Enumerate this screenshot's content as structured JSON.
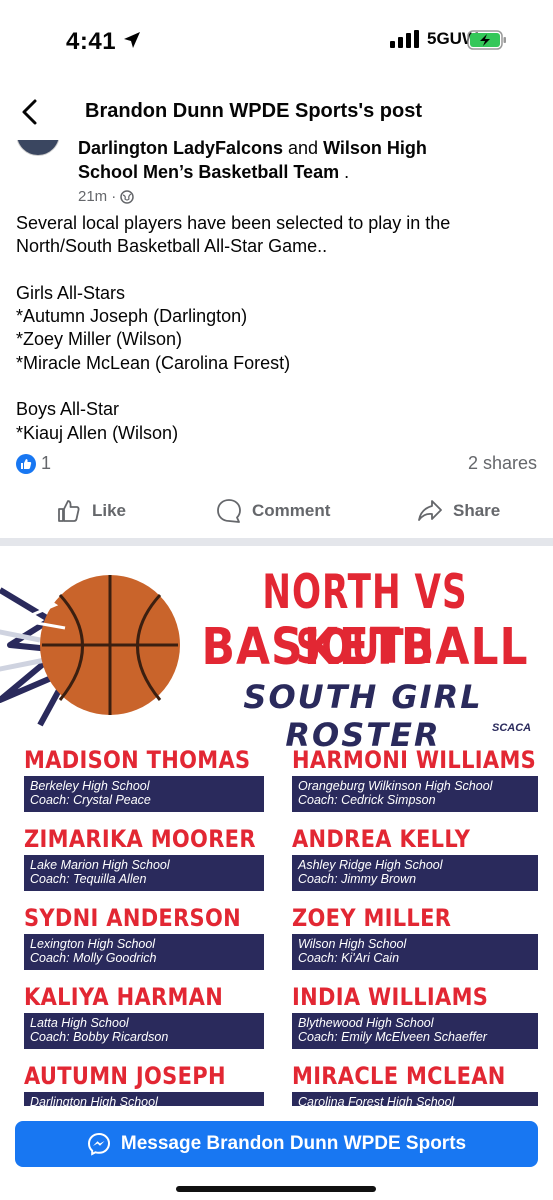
{
  "status_bar": {
    "time": "4:41",
    "network": "5GUW"
  },
  "nav": {
    "title": "Brandon Dunn WPDE Sports's post"
  },
  "post": {
    "header_line1_bold_a": "Darlington LadyFalcons",
    "header_line1_thin": " and ",
    "header_line1_bold_b": "Wilson High",
    "header_line2": "School Men’s Basketball Team",
    "header_line2_tail": " .",
    "time": "21m",
    "body": "Several local players have been selected to play in the North/South Basketball All-Star Game..\n\nGirls All-Stars\n*Autumn Joseph (Darlington)\n*Zoey Miller (Wilson)\n*Miracle McLean (Carolina Forest)\n\nBoys All-Star\n*Kiauj Allen (Wilson)",
    "reaction_count": "1",
    "shares": "2 shares"
  },
  "actions": {
    "like": "Like",
    "comment": "Comment",
    "share": "Share"
  },
  "graphic": {
    "title_line1": "NORTH VS SOUTH",
    "title_line2": "BASKETBALL",
    "title_line3": "SOUTH GIRL ROSTER",
    "logo": "SCACA",
    "players": [
      {
        "name": "MADISON THOMAS",
        "school": "Berkeley High School",
        "coach": "Coach: Crystal Peace"
      },
      {
        "name": "HARMONI WILLIAMS",
        "school": "Orangeburg Wilkinson High School",
        "coach": "Coach: Cedrick Simpson"
      },
      {
        "name": "ZIMARIKA MOORER",
        "school": "Lake Marion High School",
        "coach": "Coach: Tequilla Allen"
      },
      {
        "name": "ANDREA KELLY",
        "school": "Ashley Ridge High School",
        "coach": "Coach: Jimmy Brown"
      },
      {
        "name": "SYDNI ANDERSON",
        "school": "Lexington High School",
        "coach": "Coach: Molly Goodrich"
      },
      {
        "name": "ZOEY MILLER",
        "school": "Wilson High School",
        "coach": "Coach: Ki'Ari Cain"
      },
      {
        "name": "KALIYA HARMAN",
        "school": "Latta High School",
        "coach": "Coach: Bobby Ricardson"
      },
      {
        "name": "INDIA WILLIAMS",
        "school": "Blythewood High School",
        "coach": "Coach: Emily McElveen Schaeffer"
      },
      {
        "name": "AUTUMN JOSEPH",
        "school": "Darlington High School",
        "coach": ""
      },
      {
        "name": "MIRACLE MCLEAN",
        "school": "Carolina Forest High School",
        "coach": ""
      }
    ]
  },
  "message_button": {
    "label": "Message Brandon Dunn WPDE Sports"
  },
  "colors": {
    "fb_blue": "#1877f2",
    "roster_red": "#e22733",
    "roster_navy": "#2a2a5c",
    "muted": "#65676b"
  }
}
